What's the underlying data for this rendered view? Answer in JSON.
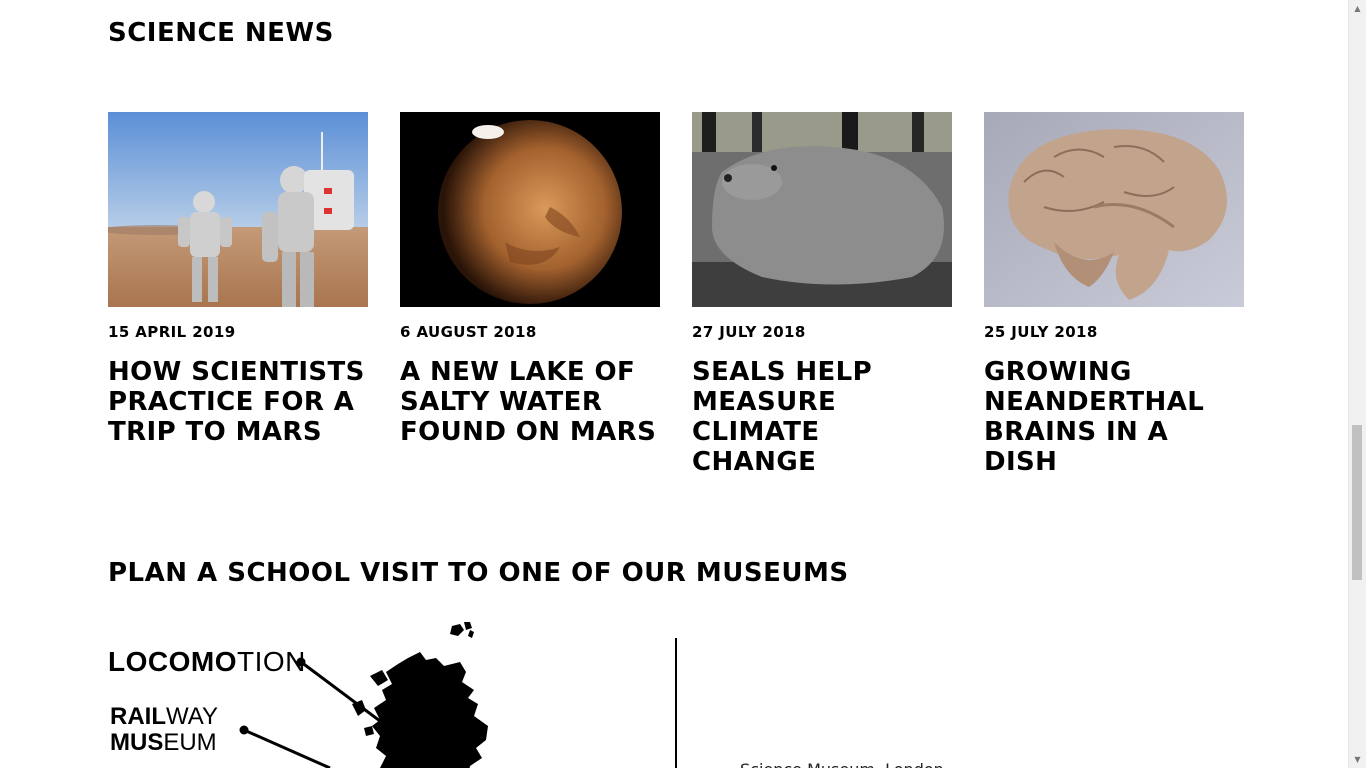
{
  "science_news": {
    "title": "SCIENCE NEWS",
    "cards": [
      {
        "date": "15 APRIL 2019",
        "headline": "HOW SCIENTISTS PRACTICE FOR A TRIP TO MARS",
        "image": "astronauts-in-desert"
      },
      {
        "date": "6 AUGUST 2018",
        "headline": "A NEW LAKE OF SALTY WATER FOUND ON MARS",
        "image": "planet-mars"
      },
      {
        "date": "27 JULY 2018",
        "headline": "SEALS HELP MEASURE CLIMATE CHANGE",
        "image": "elephant-seal"
      },
      {
        "date": "25 JULY 2018",
        "headline": "GROWING NEANDERTHAL BRAINS IN A DISH",
        "image": "brain-cross-section"
      }
    ]
  },
  "plan_visit": {
    "title": "PLAN A SCHOOL VISIT TO ONE OF OUR MUSEUMS",
    "museums": {
      "locomotion_bold": "LOCOMO",
      "locomotion_light": "TION",
      "railway_bold": "RAIL",
      "railway_light": "WAY",
      "museum_bold": "MUS",
      "museum_light": "EUM"
    },
    "partial_text": "Science Museum, London"
  },
  "colors": {
    "text": "#000000",
    "background": "#ffffff",
    "scrollbar_track": "#f1f1f1",
    "scrollbar_thumb": "#c1c1c1"
  }
}
